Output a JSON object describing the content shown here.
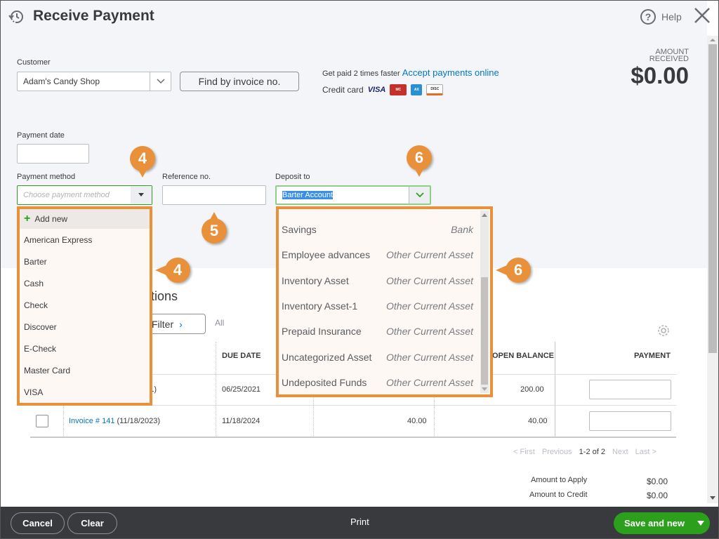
{
  "header": {
    "title": "Receive Payment",
    "help_label": "Help"
  },
  "customer": {
    "label": "Customer",
    "value": "Adam's Candy Shop",
    "find_button": "Find by invoice no."
  },
  "promo": {
    "text": "Get paid 2 times faster",
    "link": "Accept payments online",
    "credit_card_label": "Credit card",
    "cards": [
      "VISA",
      "MasterCard",
      "American Express",
      "DISCOVER"
    ]
  },
  "amount": {
    "label_line1": "AMOUNT",
    "label_line2": "RECEIVED",
    "value": "$0.00"
  },
  "payment_date": {
    "label": "Payment date",
    "value": ""
  },
  "payment_method": {
    "label": "Payment method",
    "placeholder": "Choose payment method",
    "options": [
      "Add new",
      "American Express",
      "Barter",
      "Cash",
      "Check",
      "Discover",
      "E-Check",
      "Master Card",
      "VISA"
    ]
  },
  "reference": {
    "label": "Reference no.",
    "value": ""
  },
  "deposit_to": {
    "label": "Deposit to",
    "value": "Barter Account",
    "options": [
      {
        "name": "Savings",
        "type": "Bank"
      },
      {
        "name": "Employee advances",
        "type": "Other Current Asset"
      },
      {
        "name": "Inventory Asset",
        "type": "Other Current Asset"
      },
      {
        "name": "Inventory Asset-1",
        "type": "Other Current Asset"
      },
      {
        "name": "Prepaid Insurance",
        "type": "Other Current Asset"
      },
      {
        "name": "Uncategorized Asset",
        "type": "Other Current Asset"
      },
      {
        "name": "Undeposited Funds",
        "type": "Other Current Asset"
      }
    ]
  },
  "callouts": {
    "c4": "4",
    "c5": "5",
    "c6": "6"
  },
  "transactions": {
    "title_partial": "tions",
    "filter_label": "Filter",
    "all_label": "All",
    "columns": [
      "DUE DATE",
      "OPEN BALANCE",
      "PAYMENT"
    ],
    "rows": [
      {
        "desc_partial": "021)",
        "due_date": "06/25/2021",
        "original": "",
        "open_balance": "200.00"
      },
      {
        "invoice_link": "Invoice # 141",
        "invoice_date": "(11/18/2023)",
        "due_date": "11/18/2024",
        "original": "40.00",
        "open_balance": "40.00"
      }
    ],
    "pager": {
      "first": "< First",
      "previous": "Previous",
      "range": "1-2 of 2",
      "next": "Next",
      "last": "Last >"
    }
  },
  "summary": {
    "apply_label": "Amount to Apply",
    "apply_value": "$0.00",
    "credit_label": "Amount to Credit",
    "credit_value": "$0.00"
  },
  "footer": {
    "cancel": "Cancel",
    "clear": "Clear",
    "print": "Print",
    "save": "Save and new"
  }
}
